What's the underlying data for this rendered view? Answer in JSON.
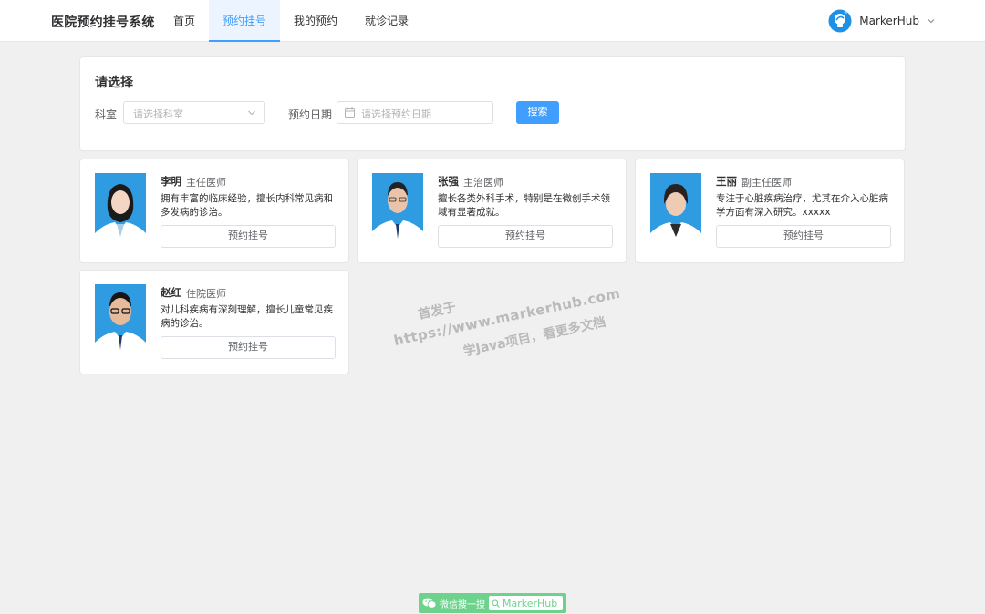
{
  "header": {
    "brand": "医院预约挂号系统",
    "nav": [
      {
        "label": "首页",
        "active": false
      },
      {
        "label": "预约挂号",
        "active": true
      },
      {
        "label": "我的预约",
        "active": false
      },
      {
        "label": "就诊记录",
        "active": false
      }
    ],
    "user": {
      "name": "MarkerHub",
      "avatar_icon": "light-bulb-avatar",
      "menu_icon": "chevron-down-icon"
    }
  },
  "filter": {
    "title": "请选择",
    "department_label": "科室",
    "department_placeholder": "请选择科室",
    "date_label": "预约日期",
    "date_placeholder": "请选择预约日期",
    "search_label": "搜索"
  },
  "doctors": [
    {
      "name": "李明",
      "title": "主任医师",
      "description": "拥有丰富的临床经验，擅长内科常见病和多发病的诊治。",
      "book_label": "预约挂号"
    },
    {
      "name": "张强",
      "title": "主治医师",
      "description": "擅长各类外科手术，特别是在微创手术领域有显著成就。",
      "book_label": "预约挂号"
    },
    {
      "name": "王丽",
      "title": "副主任医师",
      "description": "专注于心脏疾病治疗，尤其在介入心脏病学方面有深入研究。xxxxx",
      "book_label": "预约挂号"
    },
    {
      "name": "赵红",
      "title": "住院医师",
      "description": "对儿科疾病有深刻理解，擅长儿童常见疾病的诊治。",
      "book_label": "预约挂号"
    }
  ],
  "watermark": {
    "line1": "首发于",
    "line2": "https://www.markerhub.com",
    "line3": "学Java项目，看更多文档"
  },
  "badge": {
    "text": "微信搜一搜",
    "search_text": "MarkerHub"
  },
  "colors": {
    "primary": "#409eff",
    "background": "#f0f0f0",
    "badge_green": "#6cd28c"
  }
}
